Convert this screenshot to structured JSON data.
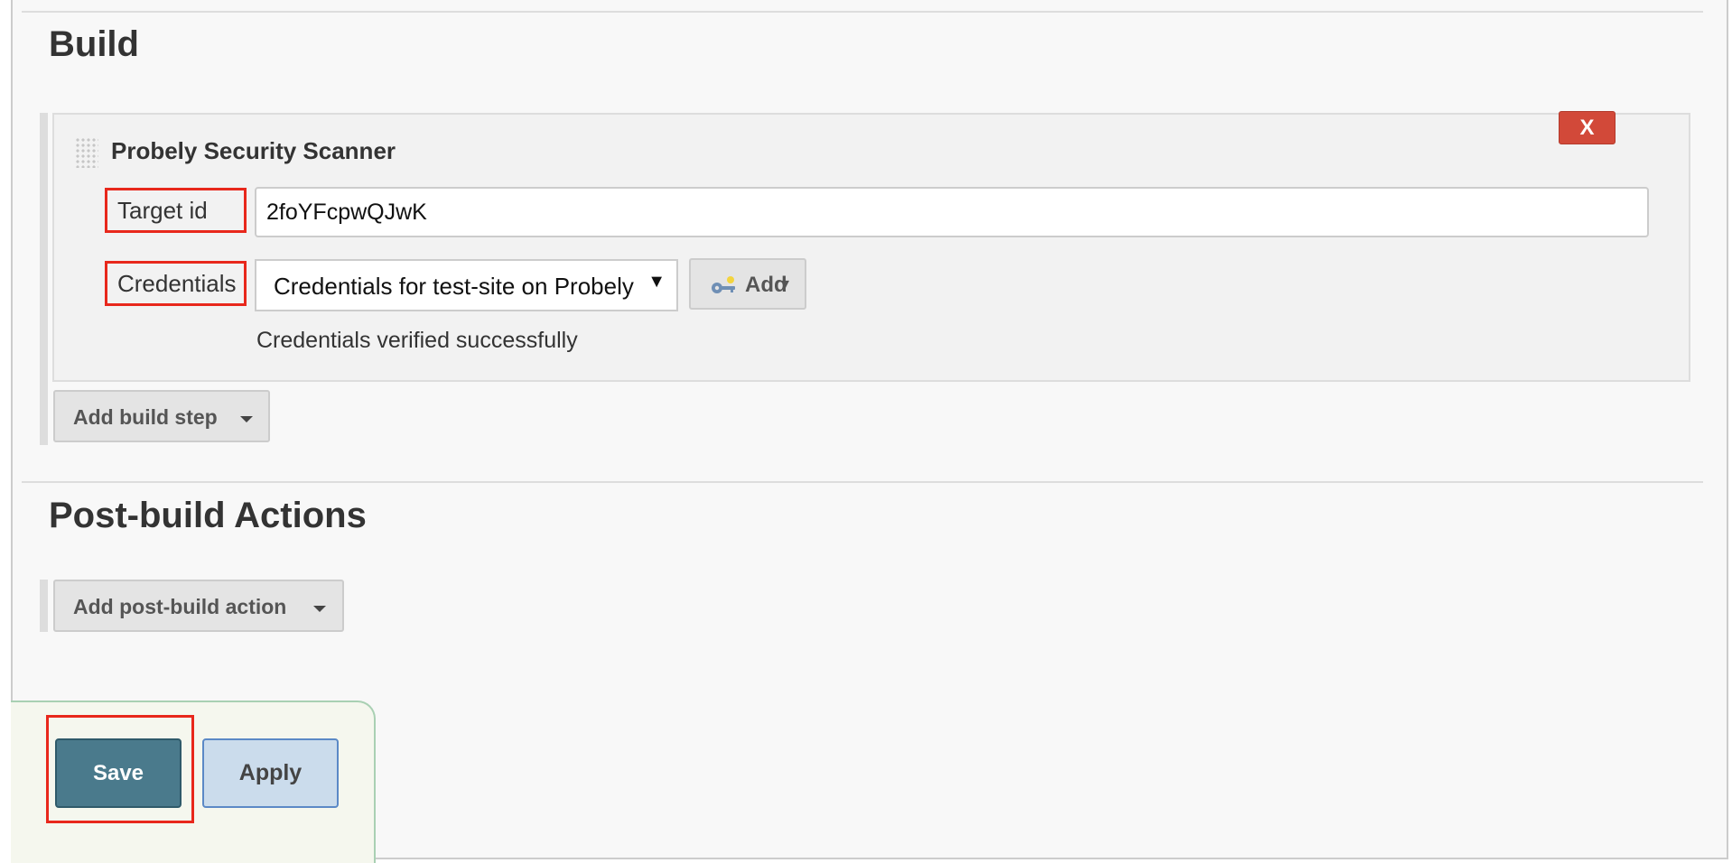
{
  "build": {
    "title": "Build",
    "step": {
      "title": "Probely Security Scanner",
      "delete_label": "X",
      "target_id": {
        "label": "Target id",
        "value": "2foYFcpwQJwK"
      },
      "credentials": {
        "label": "Credentials",
        "selected": "Credentials for test-site on Probely",
        "add_label": "Add",
        "add_icon": "key-icon",
        "status": "Credentials verified successfully"
      }
    },
    "add_step_label": "Add build step"
  },
  "post_build": {
    "title": "Post-build Actions",
    "add_action_label": "Add post-build action"
  },
  "footer": {
    "save_label": "Save",
    "apply_label": "Apply"
  },
  "colors": {
    "delete_button": "#d24939",
    "save_button": "#4a7a8c",
    "apply_button": "#cbdcec",
    "highlight_box": "#e8281c"
  }
}
